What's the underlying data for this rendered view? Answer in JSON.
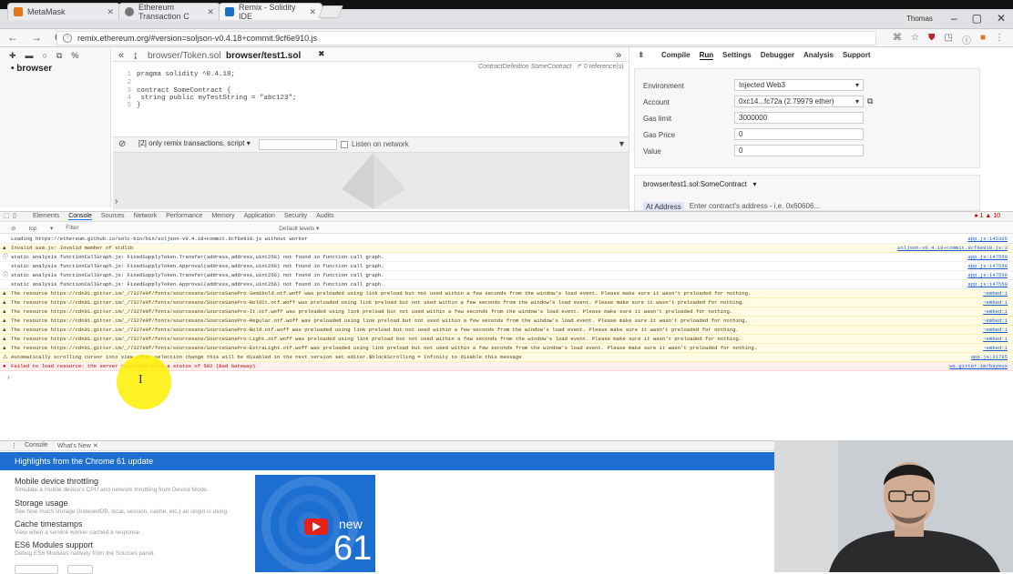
{
  "browser": {
    "tabs": [
      {
        "label": "MetaMask",
        "color": "#e2761b"
      },
      {
        "label": "Ethereum Transaction C",
        "color": "#777777"
      },
      {
        "label": "Remix - Solidity IDE",
        "color": "#1e6ec7"
      }
    ],
    "profile": "Thomas",
    "window_controls": {
      "minimize": "–",
      "restore": "▢",
      "close": "✕"
    },
    "address": "remix.ethereum.org/#version=soljson-v0.4.18+commit.9cf6e910.js",
    "nav": {
      "back": "←",
      "forward": "→",
      "reload": "C"
    }
  },
  "remix": {
    "file_browser": {
      "root": "• browser"
    },
    "editor_tabs": [
      "browser/Token.sol",
      "browser/test1.sol"
    ],
    "contract_info": "ContractDefinition SomeContract",
    "references": "0 reference(s)",
    "code_lines": [
      {
        "n": "1",
        "text": "pragma solidity ^0.4.18;"
      },
      {
        "n": "2",
        "text": ""
      },
      {
        "n": "3",
        "text": "contract SomeContract {"
      },
      {
        "n": "4",
        "text": "    string public myTestString = \"abc123\";"
      },
      {
        "n": "5",
        "text": "}"
      }
    ],
    "terminal": {
      "filter_select": "[2] only remix transactions, script",
      "listen_label": "Listen on network"
    },
    "right_tabs": [
      "Compile",
      "Run",
      "Settings",
      "Debugger",
      "Analysis",
      "Support"
    ],
    "run": {
      "environment_label": "Environment",
      "environment_value": "Injected Web3",
      "account_label": "Account",
      "account_value": "0xc14...fc72a (2.79979 ether)",
      "gas_limit_label": "Gas limit",
      "gas_limit_value": "3000000",
      "gas_price_label": "Gas Price",
      "gas_price_value": "0",
      "value_label": "Value",
      "value_value": "0",
      "contract_select": "browser/test1.sol:SomeContract",
      "at_address_button": "At Address",
      "at_address_placeholder": "Enter contract's address - i.e. 0x60606..."
    }
  },
  "devtools": {
    "tabs": [
      "Elements",
      "Console",
      "Sources",
      "Network",
      "Performance",
      "Memory",
      "Application",
      "Security",
      "Audits"
    ],
    "counts": "● 1  ▲ 10",
    "filter": {
      "context": "top",
      "placeholder": "Filter",
      "levels": "Default levels ▾"
    },
    "console_rows": [
      {
        "type": "info",
        "icon": "",
        "text": "Loading https://ethereum.github.io/solc-bin/bin/soljson-v0.4.18+commit.9cf6e910.js without worker",
        "src": "app.js:145305"
      },
      {
        "type": "warn",
        "icon": "▲",
        "text": "Invalid asm.js: Invalid member of stdlib",
        "src": "soljson-v0.4.18+commit.9cf6e910.js:3"
      },
      {
        "type": "info",
        "icon": "ⓘ",
        "text": "static analysis functionCallGraph.js: FixedSupplyToken.Transfer(address,address,uint256) not found in function call graph.",
        "src": "app.js:147559"
      },
      {
        "type": "info",
        "icon": "",
        "text": "static analysis functionCallGraph.js: FixedSupplyToken.Approval(address,address,uint256) not found in function call graph.",
        "src": "app.js:147559"
      },
      {
        "type": "info",
        "icon": "ⓘ",
        "text": "static analysis functionCallGraph.js: FixedSupplyToken.Transfer(address,address,uint256) not found in function call graph.",
        "src": "app.js:147559"
      },
      {
        "type": "info",
        "icon": "",
        "text": "static analysis functionCallGraph.js: FixedSupplyToken.Approval(address,address,uint256) not found in function call graph.",
        "src": "app.js:147559"
      },
      {
        "type": "warn",
        "icon": "▲",
        "text": "The resource https://cdn01.gitter.im/_/7327e0f/fonts/sourcesans/SourceSansPro-Semibold.otf.woff was preloaded using link preload but not used within a few seconds from the window's load event. Please make sure it wasn't preloaded for nothing.",
        "src": "~embed:1"
      },
      {
        "type": "warn",
        "icon": "▲",
        "text": "The resource https://cdn01.gitter.im/_/7327e0f/fonts/sourcesans/SourceSansPro-BoldIt.otf.woff was preloaded using link preload but not used within a few seconds from the window's load event. Please make sure it wasn't preloaded for nothing.",
        "src": "~embed:1"
      },
      {
        "type": "warn",
        "icon": "▲",
        "text": "The resource https://cdn01.gitter.im/_/7327e0f/fonts/sourcesans/SourceSansPro-It.otf.woff was preloaded using link preload but not used within a few seconds from the window's load event. Please make sure it wasn't preloaded for nothing.",
        "src": "~embed:1"
      },
      {
        "type": "warn",
        "icon": "▲",
        "text": "The resource https://cdn01.gitter.im/_/7327e0f/fonts/sourcesans/SourceSansPro-Regular.otf.woff was preloaded using link preload but not used within a few seconds from the window's load event. Please make sure it wasn't preloaded for nothing.",
        "src": "~embed:1"
      },
      {
        "type": "warn",
        "icon": "▲",
        "text": "The resource https://cdn01.gitter.im/_/7327e0f/fonts/sourcesans/SourceSansPro-Bold.otf.woff was preloaded using link preload but not used within a few seconds from the window's load event. Please make sure it wasn't preloaded for nothing.",
        "src": "~embed:1"
      },
      {
        "type": "warn",
        "icon": "▲",
        "text": "The resource https://cdn01.gitter.im/_/7327e0f/fonts/sourcesans/SourceSansPro-Light.otf.woff was preloaded using link preload but not used within a few seconds from the window's load event. Please make sure it wasn't preloaded for nothing.",
        "src": "~embed:1"
      },
      {
        "type": "warn",
        "icon": "▲",
        "text": "The resource https://cdn01.gitter.im/_/7327e0f/fonts/sourcesans/SourceSansPro-ExtraLight.otf.woff was preloaded using link preload but not used within a few seconds from the window's load event. Please make sure it wasn't preloaded for nothing.",
        "src": "~embed:1"
      },
      {
        "type": "warn",
        "icon": "⚠",
        "text": "Automatically scrolling cursor into view after selection change this will be disabled in the next version set editor.$blockScrolling = Infinity to disable this message",
        "src": "app.js:21785"
      },
      {
        "type": "err",
        "icon": "●",
        "text": "Failed to load resource: the server responded with a status of 502 (Bad Gateway)",
        "src": "ws.gitter.im/bayeux"
      }
    ],
    "prompt": "›"
  },
  "drawer": {
    "tabs": [
      "Console",
      "What's New ✕"
    ],
    "title": "Highlights from the Chrome 61 update",
    "items": [
      {
        "title": "Mobile device throttling",
        "desc": "Simulate a mobile device's CPU and network throttling from Device Mode."
      },
      {
        "title": "Storage usage",
        "desc": "See how much storage (IndexedDB, local, session, cache, etc.) an origin is using."
      },
      {
        "title": "Cache timestamps",
        "desc": "View when a service worker cached a response."
      },
      {
        "title": "ES6 Modules support",
        "desc": "Debug ES6 Modules natively from the Sources panel."
      }
    ],
    "promo_new": "new",
    "promo_version": "61"
  }
}
